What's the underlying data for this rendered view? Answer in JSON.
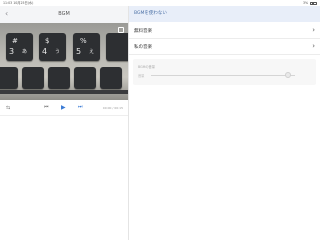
{
  "status_bar": {
    "time": "11:03",
    "date": "10月25日(水)",
    "battery": "3%"
  },
  "left": {
    "title": "BGM",
    "back_icon": "chevron-left-icon",
    "controls": {
      "time": "00:00 / 00:15"
    }
  },
  "right": {
    "no_bgm_label": "BGMを使わない",
    "items": [
      {
        "label": "無料音楽"
      },
      {
        "label": "私の音楽"
      }
    ],
    "volume": {
      "title": "BGMの音量",
      "sub_label": "音量",
      "level": 0.95
    }
  },
  "colors": {
    "accent": "#3a7bd5",
    "selected_bg": "#e8eef9",
    "header_bg": "#f4f5f7"
  }
}
